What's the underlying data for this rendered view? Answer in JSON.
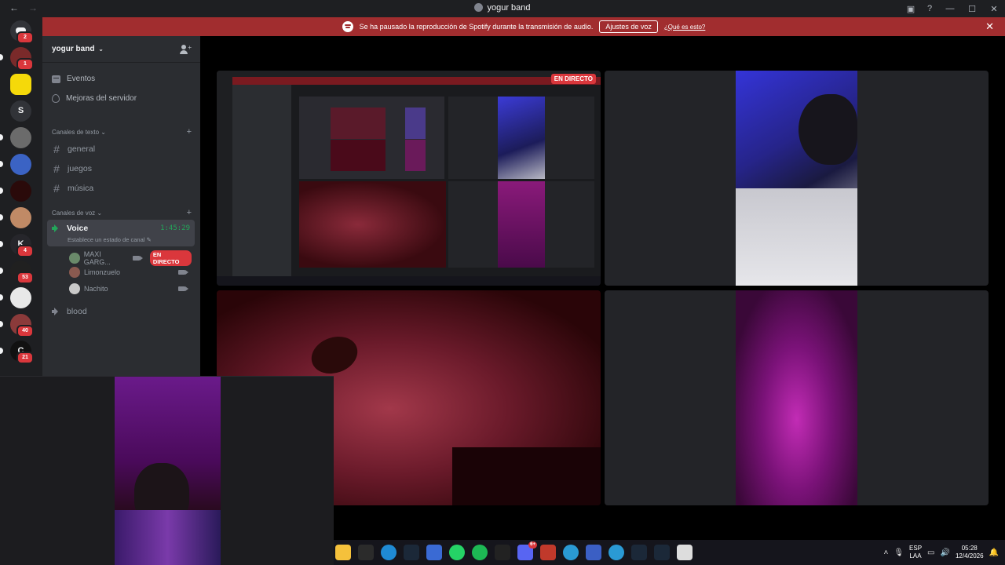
{
  "window": {
    "back": "←",
    "forward": "→",
    "title": "yogur band",
    "controls": {
      "minimize": "—",
      "maximize": "☐",
      "close": "✕"
    }
  },
  "banner": {
    "message": "Se ha pausado la reproducción de Spotify durante la transmisión de audio.",
    "button": "Ajustes de voz",
    "link": "¿Qué es esto?",
    "close": "✕"
  },
  "guilds": [
    {
      "name": "discord-home",
      "badge": "2",
      "color": "#313338"
    },
    {
      "name": "guild-avatar-1",
      "badge": "1",
      "color": "#7a2a2a"
    },
    {
      "name": "guild-yellow",
      "badge": "",
      "color": "#f5d90a"
    },
    {
      "name": "guild-s",
      "badge": "",
      "color": "#313338",
      "letter": "S"
    },
    {
      "name": "guild-car",
      "badge": "",
      "color": "#6b6b6b"
    },
    {
      "name": "guild-blue",
      "badge": "",
      "color": "#3b63c4"
    },
    {
      "name": "guild-dark",
      "badge": "",
      "color": "#2a0a0a"
    },
    {
      "name": "guild-face",
      "badge": "",
      "color": "#c08a66"
    },
    {
      "name": "guild-kfc",
      "badge": "4",
      "color": "#26262b",
      "letter": "K"
    },
    {
      "name": "guild-circle",
      "badge": "53",
      "color": "#202020"
    },
    {
      "name": "guild-map",
      "badge": "",
      "color": "#e8e8e8"
    },
    {
      "name": "guild-red",
      "badge": "40",
      "color": "#8b3a3a"
    },
    {
      "name": "guild-c",
      "badge": "21",
      "color": "#111",
      "letter": "C"
    }
  ],
  "sidebar": {
    "server_name": "yogur band",
    "chevron": "⌄",
    "events": "Eventos",
    "boosts": "Mejoras del servidor",
    "text_category": "Canales de texto",
    "text_channels": [
      "general",
      "juegos",
      "música"
    ],
    "voice_category": "Canales de voz",
    "plus": "+",
    "hash": "#",
    "voice_channel": {
      "name": "Voice",
      "time": "1:45:29",
      "status": "Establece un estado de canal ✎"
    },
    "members": [
      {
        "name": "MAXI GARG...",
        "live": "EN DIRECTO",
        "color": "#6a8a6a"
      },
      {
        "name": "Limonzuelo",
        "live": "",
        "color": "#8a5a50"
      },
      {
        "name": "Nachito",
        "live": "",
        "color": "#c9c9c9"
      }
    ],
    "other_voice": "blood"
  },
  "stage": {
    "live_label": "EN DIRECTO"
  },
  "taskbar": {
    "apps": [
      "file-explorer",
      "epic-games",
      "edge",
      "steam",
      "app-blue",
      "whatsapp",
      "spotify",
      "app-spider",
      "discord",
      "app-voice",
      "app-c",
      "app-w",
      "app-c2",
      "steam-2",
      "steam-3",
      "app-print"
    ],
    "discord_badge": "6+",
    "lang_top": "ESP",
    "lang_bottom": "LAA",
    "time": "05:28",
    "date": "12/4/2026"
  }
}
